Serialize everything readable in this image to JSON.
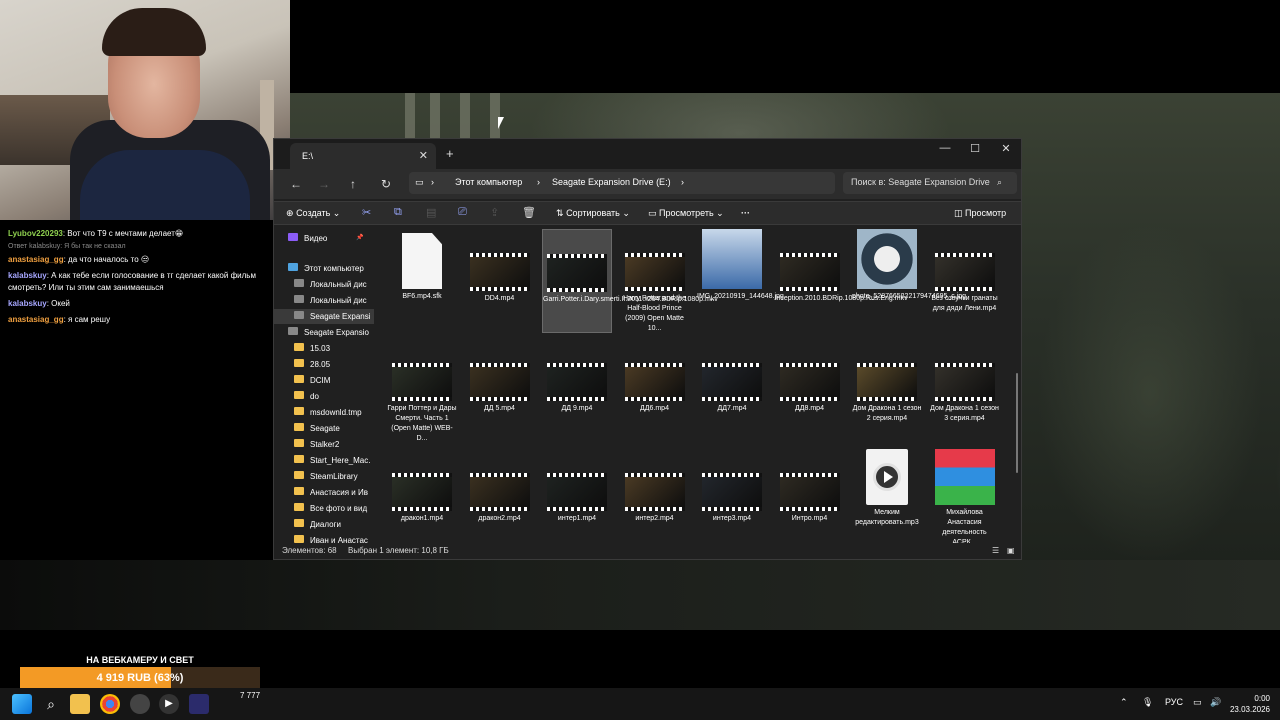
{
  "chat": [
    {
      "user": "Lyubov220293",
      "user_color": "#8fd14f",
      "text": ": Вот что Т9 с мечтами делает😁"
    },
    {
      "reply_note": "Ответ kalabskuy: Я бы так не сказал"
    },
    {
      "user": "anastasiag_gg",
      "user_color": "#f0a040",
      "text": ": да что началось то 😒"
    },
    {
      "user": "kalabskuy",
      "user_color": "#a7a7ff",
      "text": ": А как тебе если голосование в тг сделает какой фильм смотреть? Или ты этим сам занимаешься"
    },
    {
      "user": "kalabskuy",
      "user_color": "#a7a7ff",
      "text": ": Окей"
    },
    {
      "user": "anastasiag_gg",
      "user_color": "#f0a040",
      "text": ": я сам решу"
    }
  ],
  "donation": {
    "title": "НА ВЕБКАМЕРУ И СВЕТ",
    "amount_text": "4 919 RUB (63%)",
    "progress": 0.63
  },
  "explorer": {
    "tab_title": "E:\\",
    "new_tab": "+",
    "address": {
      "root": "Этот компьютер",
      "drive": "Seagate Expansion Drive (E:)"
    },
    "search_placeholder": "Поиск в: Seagate Expansion Drive",
    "toolbar": {
      "create": "Создать",
      "sort": "Сортировать",
      "view": "Просмотреть",
      "more": "···",
      "preview": "Просмотр"
    },
    "sidebar": [
      {
        "label": "Видео",
        "icon": "video-icon",
        "pinned": true
      },
      {
        "label": "Этот компьютер",
        "icon": "pc-icon"
      },
      {
        "label": "Локальный дис",
        "icon": "drive-icon"
      },
      {
        "label": "Локальный дис",
        "icon": "drive-icon"
      },
      {
        "label": "Seagate Expansi",
        "icon": "drive-icon",
        "selected": true
      },
      {
        "label": "Seagate Expansio",
        "icon": "drive-icon"
      },
      {
        "label": "15.03",
        "icon": "folder-icon"
      },
      {
        "label": "28.05",
        "icon": "folder-icon"
      },
      {
        "label": "DCIM",
        "icon": "folder-icon"
      },
      {
        "label": "do",
        "icon": "folder-icon"
      },
      {
        "label": "msdownld.tmp",
        "icon": "folder-icon"
      },
      {
        "label": "Seagate",
        "icon": "folder-icon"
      },
      {
        "label": "Stalker2",
        "icon": "folder-icon"
      },
      {
        "label": "Start_Here_Mac.",
        "icon": "folder-icon"
      },
      {
        "label": "SteamLibrary",
        "icon": "folder-icon"
      },
      {
        "label": "Анастасия и Ив",
        "icon": "folder-icon"
      },
      {
        "label": "Все фото и вид",
        "icon": "folder-icon"
      },
      {
        "label": "Диалоги",
        "icon": "folder-icon"
      },
      {
        "label": "Иван и Анастас",
        "icon": "folder-icon"
      }
    ],
    "files": [
      {
        "name": "BF6.mp4.sfk",
        "kind": "doc"
      },
      {
        "name": "DD4.mp4",
        "kind": "video"
      },
      {
        "name": "Garri.Potter.i.Dary.smerti.II.2011.x264.BDRip.1080p.mkv",
        "kind": "video",
        "selected": true
      },
      {
        "name": "Harry Potter and the Half-Blood Prince (2009) Open Matte 10...",
        "kind": "video"
      },
      {
        "name": "IMG_20210919_144648.jpg",
        "kind": "photo"
      },
      {
        "name": "Inception.2010.BDRip.1080p.Rus.Eng.mkv",
        "kind": "video"
      },
      {
        "name": "photo_5287665222179474695_c.jpg",
        "kind": "photo"
      },
      {
        "name": "Без озвучки гранаты для дяди Лени.mp4",
        "kind": "video"
      },
      {
        "name": "Гарри Поттер и Дары Смерти. Часть 1 (Open Matte) WEB-D...",
        "kind": "video"
      },
      {
        "name": "ДД 5.mp4",
        "kind": "video"
      },
      {
        "name": "ДД 9.mp4",
        "kind": "video"
      },
      {
        "name": "ДД6.mp4",
        "kind": "video"
      },
      {
        "name": "ДД7.mp4",
        "kind": "video"
      },
      {
        "name": "ДД8.mp4",
        "kind": "video"
      },
      {
        "name": "Дом Дракона 1 сезон 2 серия.mp4",
        "kind": "video"
      },
      {
        "name": "Дом Дракона 1 сезон 3 серия.mp4",
        "kind": "video"
      },
      {
        "name": "дракон1.mp4",
        "kind": "video"
      },
      {
        "name": "дракон2.mp4",
        "kind": "video"
      },
      {
        "name": "интер1.mp4",
        "kind": "video"
      },
      {
        "name": "интер2.mp4",
        "kind": "video"
      },
      {
        "name": "интер3.mp4",
        "kind": "video"
      },
      {
        "name": "Интро.mp4",
        "kind": "video"
      },
      {
        "name": "Мелким редактировать.mp3",
        "kind": "music"
      },
      {
        "name": "Михайлова Анастасия деятельность АСРК...",
        "kind": "rar"
      }
    ],
    "status": {
      "count": "Элементов: 68",
      "selection": "Выбран 1 элемент: 10,8 ГБ"
    }
  },
  "taskbar": {
    "counter": "7 777",
    "lang": "РУС",
    "time": "0:00",
    "date": "23.03.2026"
  }
}
